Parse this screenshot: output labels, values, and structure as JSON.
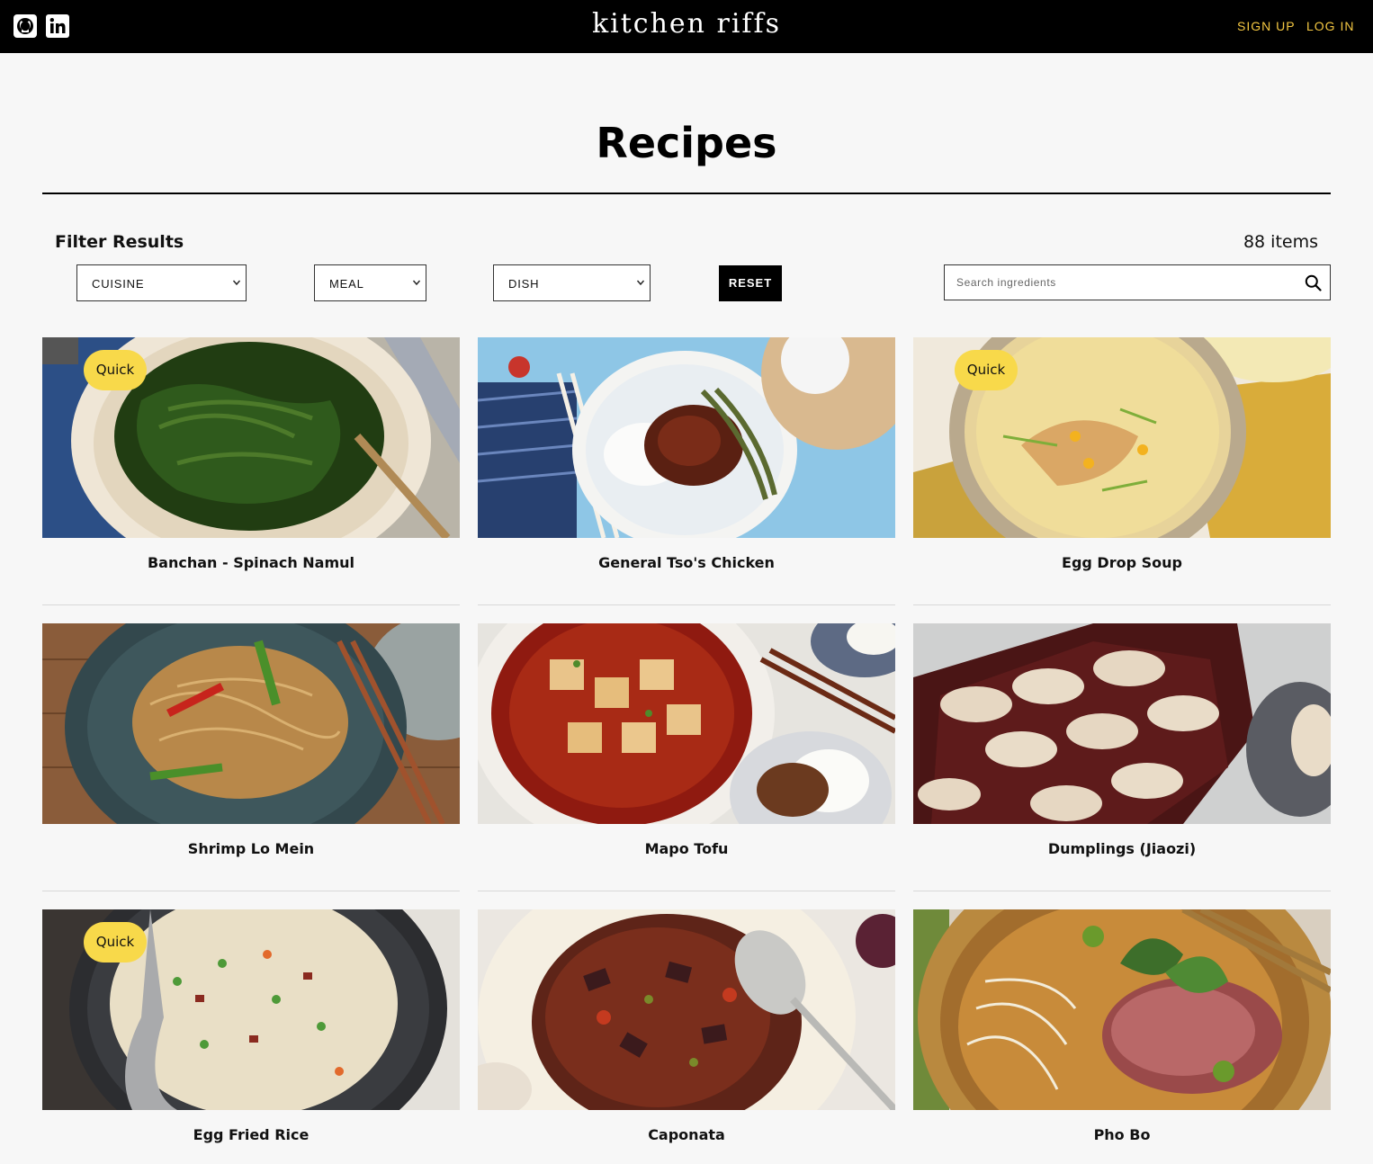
{
  "header": {
    "brand": "kitchen riffs",
    "social": [
      "github-icon",
      "linkedin-icon"
    ],
    "sign_up": "SIGN UP",
    "log_in": "LOG IN",
    "accent_color": "#f5c842"
  },
  "page": {
    "title": "Recipes"
  },
  "filters": {
    "label": "Filter Results",
    "count": "88 items",
    "cuisine": "CUISINE",
    "meal": "MEAL",
    "dish": "DISH",
    "reset": "RESET",
    "search_placeholder": "Search ingredients"
  },
  "recipes": [
    {
      "name": "Banchan - Spinach Namul",
      "badge": "Quick"
    },
    {
      "name": "General Tso's Chicken",
      "badge": ""
    },
    {
      "name": "Egg Drop Soup",
      "badge": "Quick"
    },
    {
      "name": "Shrimp Lo Mein",
      "badge": ""
    },
    {
      "name": "Mapo Tofu",
      "badge": ""
    },
    {
      "name": "Dumplings (Jiaozi)",
      "badge": ""
    },
    {
      "name": "Egg Fried Rice",
      "badge": "Quick"
    },
    {
      "name": "Caponata",
      "badge": ""
    },
    {
      "name": "Pho Bo",
      "badge": ""
    }
  ],
  "badge_color": "#f8d94a"
}
